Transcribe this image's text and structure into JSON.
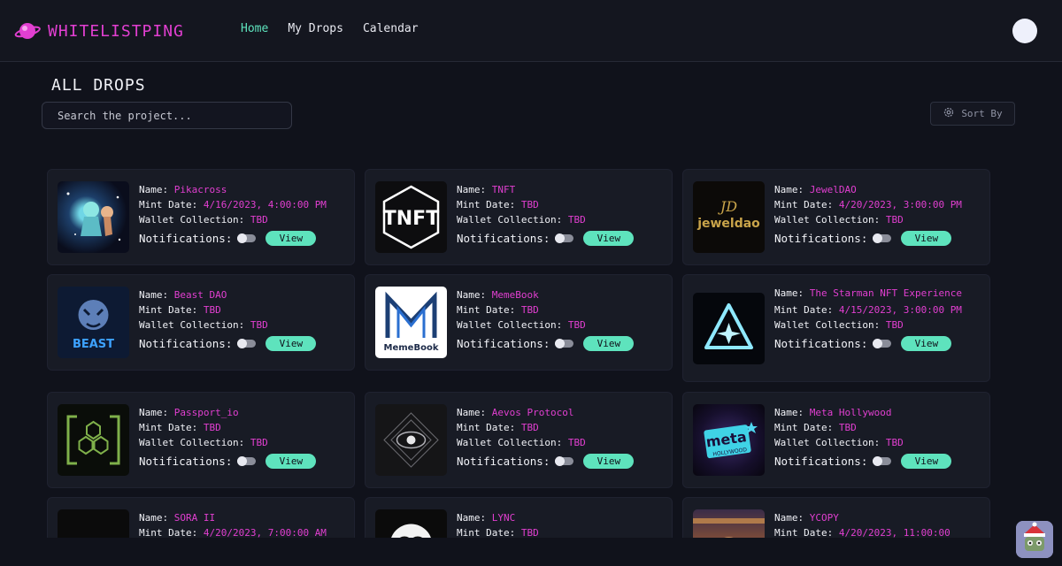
{
  "app": {
    "name": "WHITELISTPING"
  },
  "nav": {
    "items": [
      "Home",
      "My Drops",
      "Calendar"
    ],
    "active": 0
  },
  "page": {
    "title": "ALL DROPS"
  },
  "search": {
    "placeholder": "Search the project..."
  },
  "sort": {
    "label": "Sort By"
  },
  "labels": {
    "name": "Name:",
    "mint": "Mint Date:",
    "wallet": "Wallet Collection:",
    "notifications": "Notifications:",
    "view": "View"
  },
  "colors": {
    "accent_pink": "#e23fd1",
    "accent_green": "#5ee3bd",
    "background": "#10121b",
    "card": "#181b25"
  },
  "drops": [
    {
      "name": "Pikacross",
      "mint": "4/16/2023, 4:00:00 PM",
      "wallet": "TBD",
      "image": "pikacross-art"
    },
    {
      "name": "TNFT",
      "mint": "TBD",
      "wallet": "TBD",
      "image": "tnft-logo"
    },
    {
      "name": "JewelDAO",
      "mint": "4/20/2023, 3:00:00 PM",
      "wallet": "TBD",
      "image": "jeweldao-logo"
    },
    {
      "name": "Beast DAO",
      "mint": "TBD",
      "wallet": "TBD",
      "image": "beast-logo"
    },
    {
      "name": "MemeBook",
      "mint": "TBD",
      "wallet": "TBD",
      "image": "memebook-logo"
    },
    {
      "name": "The Starman NFT Experience",
      "mint": "4/15/2023, 3:00:00 PM",
      "wallet": "TBD",
      "image": "starman-logo"
    },
    {
      "name": "Passport_io",
      "mint": "TBD",
      "wallet": "TBD",
      "image": "passport-logo"
    },
    {
      "name": "Aevos Protocol",
      "mint": "TBD",
      "wallet": "TBD",
      "image": "aevos-logo"
    },
    {
      "name": "Meta Hollywood",
      "mint": "TBD",
      "wallet": "TBD",
      "image": "meta-hollywood-logo"
    },
    {
      "name": "SORA II",
      "mint": "4/20/2023, 7:00:00 AM",
      "wallet": "",
      "image": "sora-logo"
    },
    {
      "name": "LYNC",
      "mint": "TBD",
      "wallet": "",
      "image": "lync-logo"
    },
    {
      "name": "YCOPY",
      "mint": "4/20/2023, 11:00:00",
      "wallet": "",
      "image": "ycopy-logo"
    }
  ]
}
